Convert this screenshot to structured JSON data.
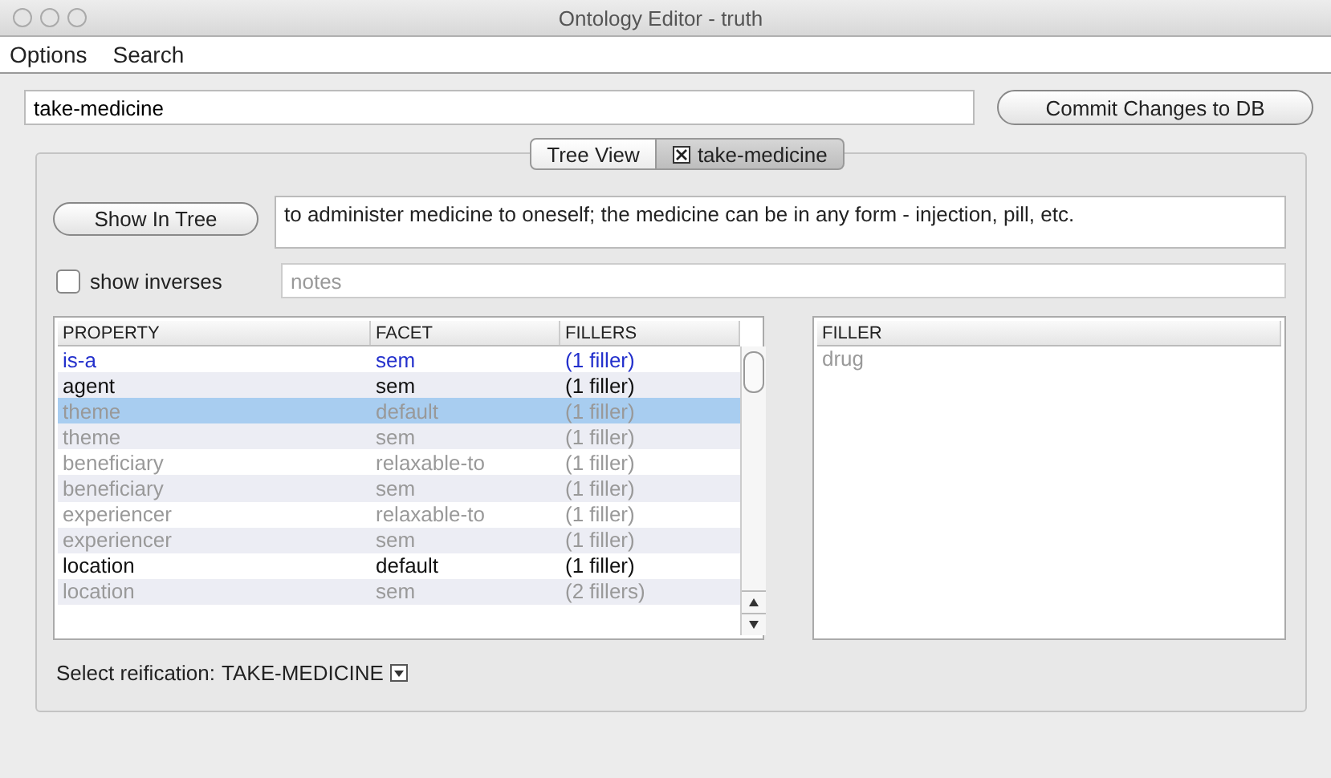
{
  "window": {
    "title": "Ontology Editor - truth"
  },
  "menu": [
    "Options",
    "Search"
  ],
  "search": {
    "value": "take-medicine"
  },
  "commit_button": "Commit Changes to DB",
  "tabs": [
    {
      "label": "Tree View",
      "selected": false,
      "closable": false
    },
    {
      "label": "take-medicine",
      "selected": true,
      "closable": true
    }
  ],
  "show_in_tree_button": "Show In Tree",
  "definition": "to administer medicine to oneself; the medicine can be in any form - injection, pill, etc.",
  "show_inverses": {
    "label": "show inverses",
    "checked": false
  },
  "notes": {
    "placeholder": "notes"
  },
  "table": {
    "columns": [
      "PROPERTY",
      "FACET",
      "FILLERS"
    ],
    "rows": [
      {
        "kind": "link",
        "selected": false,
        "cells": [
          "is-a",
          "sem",
          "(1 filler)"
        ]
      },
      {
        "kind": "local",
        "selected": false,
        "cells": [
          "agent",
          "sem",
          "(1 filler)"
        ]
      },
      {
        "kind": "inherited",
        "selected": true,
        "cells": [
          "theme",
          "default",
          "(1 filler)"
        ]
      },
      {
        "kind": "inherited",
        "selected": false,
        "cells": [
          "theme",
          "sem",
          "(1 filler)"
        ]
      },
      {
        "kind": "inherited",
        "selected": false,
        "cells": [
          "beneficiary",
          "relaxable-to",
          "(1 filler)"
        ]
      },
      {
        "kind": "inherited",
        "selected": false,
        "cells": [
          "beneficiary",
          "sem",
          "(1 filler)"
        ]
      },
      {
        "kind": "inherited",
        "selected": false,
        "cells": [
          "experiencer",
          "relaxable-to",
          "(1 filler)"
        ]
      },
      {
        "kind": "inherited",
        "selected": false,
        "cells": [
          "experiencer",
          "sem",
          "(1 filler)"
        ]
      },
      {
        "kind": "local",
        "selected": false,
        "cells": [
          "location",
          "default",
          "(1 filler)"
        ]
      },
      {
        "kind": "inherited",
        "selected": false,
        "cells": [
          "location",
          "sem",
          "(2 fillers)"
        ]
      }
    ]
  },
  "filler_table": {
    "column": "FILLER",
    "rows": [
      "drug"
    ]
  },
  "reification": {
    "label": "Select reification:",
    "value": "TAKE-MEDICINE"
  }
}
